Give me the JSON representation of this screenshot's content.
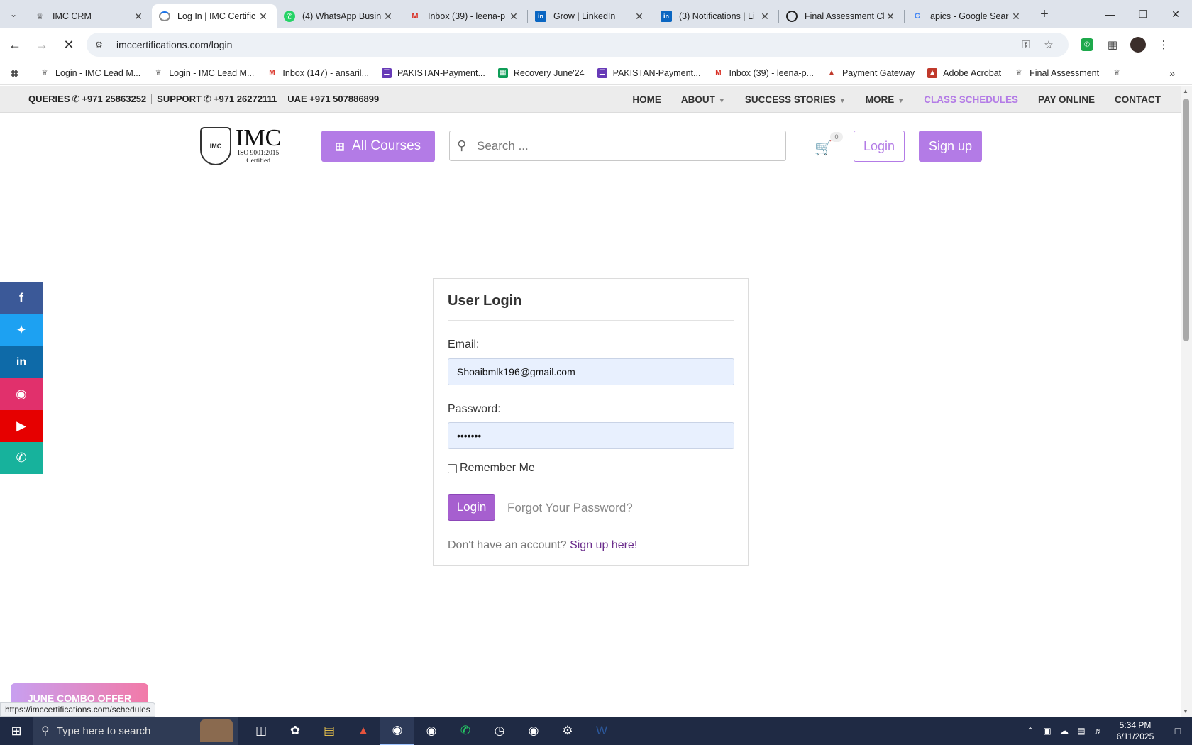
{
  "browser": {
    "tabs": [
      {
        "title": "IMC CRM",
        "icon": "imc-crest-icon",
        "active": false
      },
      {
        "title": "Log In | IMC Certific",
        "icon": "loading-icon",
        "active": true
      },
      {
        "title": "(4) WhatsApp Busin",
        "icon": "whatsapp-icon",
        "active": false
      },
      {
        "title": "Inbox (39) - leena-p",
        "icon": "gmail-icon",
        "active": false
      },
      {
        "title": "Grow | LinkedIn",
        "icon": "linkedin-icon",
        "active": false
      },
      {
        "title": "(3) Notifications | Li",
        "icon": "linkedin-icon",
        "active": false
      },
      {
        "title": "Final Assessment Cl",
        "icon": "openai-icon",
        "active": false
      },
      {
        "title": "apics - Google Sear",
        "icon": "google-icon",
        "active": false
      }
    ],
    "url": "imccertifications.com/login",
    "bookmarks": [
      {
        "label": "Login - IMC Lead M...",
        "icon": "imc-crest-icon"
      },
      {
        "label": "Login - IMC Lead M...",
        "icon": "imc-crest-icon"
      },
      {
        "label": "Inbox (147) - ansaril...",
        "icon": "gmail-icon"
      },
      {
        "label": "PAKISTAN-Payment...",
        "icon": "forms-icon"
      },
      {
        "label": "Recovery June'24",
        "icon": "sheets-icon"
      },
      {
        "label": "PAKISTAN-Payment...",
        "icon": "forms-icon"
      },
      {
        "label": "Inbox (39) - leena-p...",
        "icon": "gmail-icon"
      },
      {
        "label": "Payment Gateway",
        "icon": "acrobat-icon"
      },
      {
        "label": "Adobe Acrobat",
        "icon": "acrobat-icon"
      },
      {
        "label": "Final Assessment",
        "icon": "imc-crest-icon"
      }
    ],
    "status_url": "https://imccertifications.com/schedules"
  },
  "site": {
    "top_info": {
      "queries": "QUERIES",
      "queries_phone": "+971 25863252",
      "support": "SUPPORT",
      "support_phone": "+971 26272111",
      "uae": "UAE +971 507886899"
    },
    "nav": {
      "home": "HOME",
      "about": "ABOUT",
      "success": "SUCCESS STORIES",
      "more": "MORE",
      "schedules": "CLASS SCHEDULES",
      "pay": "PAY ONLINE",
      "contact": "CONTACT"
    },
    "logo": {
      "title": "IMC",
      "iso": "ISO 9001:2015",
      "certified": "Certified",
      "crest": "IMC"
    },
    "header": {
      "all_courses": "All Courses",
      "search_placeholder": "Search ...",
      "cart_count": "0",
      "login": "Login",
      "signup": "Sign up"
    },
    "login_card": {
      "title": "User Login",
      "email_label": "Email:",
      "email_value": "Shoaibmlk196@gmail.com",
      "password_label": "Password:",
      "password_value": "•••••••",
      "remember": "Remember Me",
      "login_button": "Login",
      "forgot": "Forgot Your Password?",
      "no_account": "Don't have an account?",
      "signup_link": "Sign up here!"
    },
    "combo_banner": "JUNE COMBO OFFER"
  },
  "taskbar": {
    "search_placeholder": "Type here to search",
    "time": "5:34 PM",
    "date": "6/11/2025"
  },
  "colors": {
    "brand_violet": "#b37be6",
    "login_button": "#a65fcf",
    "facebook": "#3b5998",
    "twitter": "#1da1f2",
    "linkedin": "#0e6aa8",
    "instagram": "#e1306c",
    "youtube": "#e60000",
    "whatsapp": "#17b29c"
  }
}
